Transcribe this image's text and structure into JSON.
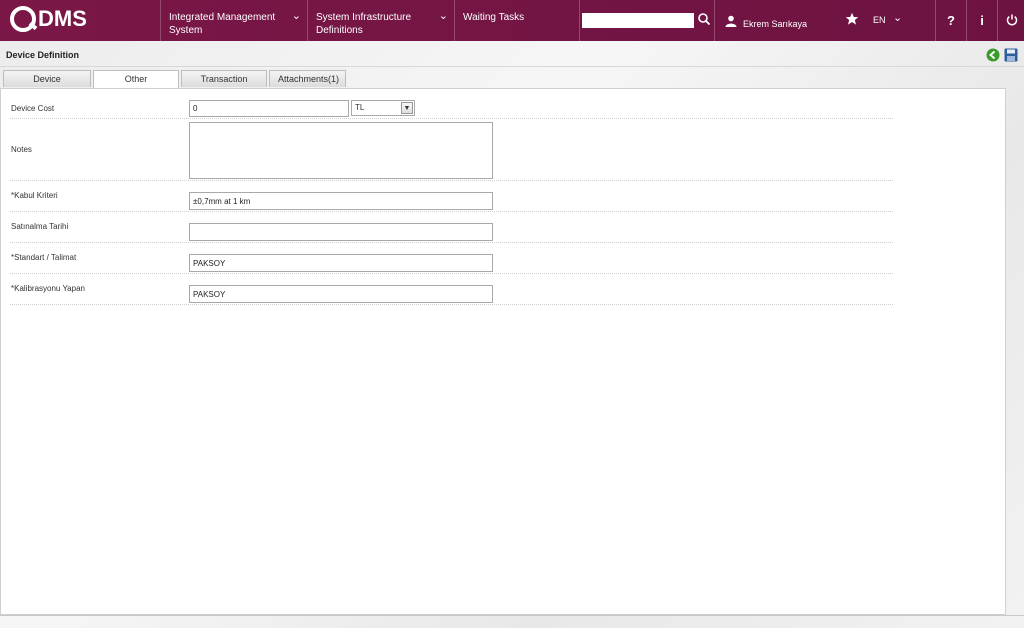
{
  "brand": {
    "logo_text": "DMS"
  },
  "nav": {
    "items": [
      {
        "label_line1": "Integrated Management",
        "label_line2": "System"
      },
      {
        "label_line1": "System Infrastructure",
        "label_line2": "Definitions"
      },
      {
        "label_line1": "Waiting Tasks",
        "label_line2": ""
      }
    ],
    "chevron": "ˇ"
  },
  "search": {
    "value": "",
    "placeholder": ""
  },
  "user": {
    "name": "Ekrem Sarıkaya"
  },
  "language": {
    "code": "EN"
  },
  "toolbar": {
    "help": "?",
    "info": "i"
  },
  "page": {
    "title": "Device Definition"
  },
  "tabs": [
    {
      "label": "Device Information",
      "active": false
    },
    {
      "label": "Other Information",
      "active": true
    },
    {
      "label": "Transaction Types",
      "active": false
    },
    {
      "label": "Attachments(1)",
      "active": false
    }
  ],
  "form": {
    "device_cost": {
      "label": "Device Cost",
      "value": "0",
      "currency": "TL"
    },
    "notes": {
      "label": "Notes",
      "value": ""
    },
    "kabul_kriteri": {
      "label": "*Kabul Kriteri",
      "value": "±0,7mm at 1 km"
    },
    "satinalma_tarihi": {
      "label": "Satınalma Tarihi",
      "value": ""
    },
    "standart_talimat": {
      "label": "*Standart / Talimat",
      "value": "PAKSOY"
    },
    "kalibrasyonu_yapan": {
      "label": "*Kalibrasyonu Yapan",
      "value": "PAKSOY"
    }
  },
  "colors": {
    "brand": "#7a1747",
    "accent_green": "#3a9a2a"
  }
}
